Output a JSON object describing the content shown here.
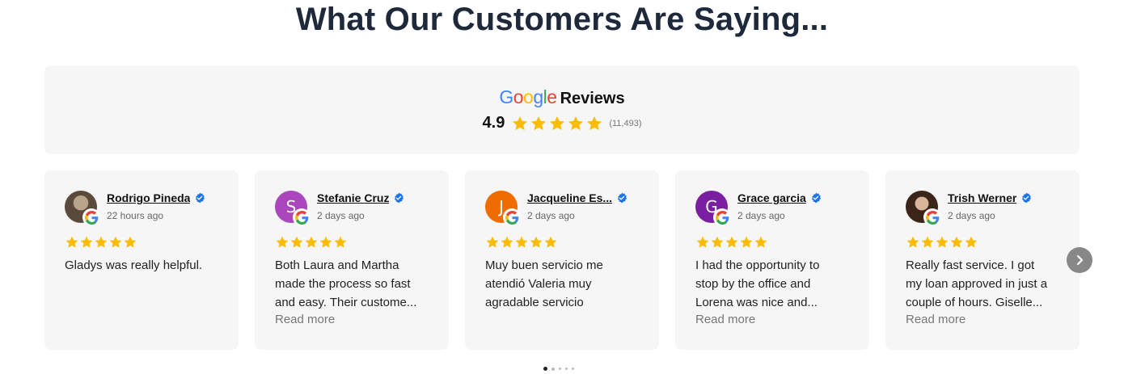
{
  "page": {
    "title": "What Our Customers Are Saying..."
  },
  "summary": {
    "brand": "Google",
    "label": "Reviews",
    "rating": "4.9",
    "stars": 5,
    "count": "(11,493)"
  },
  "colors": {
    "star": "#fbbc05",
    "verified": "#1a73e8",
    "google_blue": "#4285f4",
    "google_red": "#ea4335",
    "google_yellow": "#fbbc05",
    "google_green": "#34a853"
  },
  "reviews": [
    {
      "name": "Rodrigo Pineda",
      "time": "22 hours ago",
      "avatar": "photo",
      "stars": 5,
      "lines": [
        "Gladys was really helpful."
      ],
      "read_more": ""
    },
    {
      "name": "Stefanie Cruz",
      "time": "2 days ago",
      "avatar_letter": "S",
      "avatar_color": "#ab47bc",
      "stars": 5,
      "lines": [
        "Both Laura and Martha",
        "made the process so fast",
        "and easy. Their custome..."
      ],
      "read_more": "Read more"
    },
    {
      "name": "Jacqueline Es...",
      "time": "2 days ago",
      "avatar_letter": "J",
      "avatar_color": "#ef6c00",
      "stars": 5,
      "lines": [
        "Muy buen servicio me",
        "atendió Valeria muy",
        "agradable servicio"
      ],
      "read_more": ""
    },
    {
      "name": "Grace garcia",
      "time": "2 days ago",
      "avatar_letter": "G",
      "avatar_color": "#7b1fa2",
      "stars": 5,
      "lines": [
        "I had the opportunity to",
        "stop by the office and",
        "Lorena was nice and..."
      ],
      "read_more": "Read more"
    },
    {
      "name": "Trish Werner",
      "time": "2 days ago",
      "avatar": "photo",
      "stars": 5,
      "lines": [
        "Really fast service. I got",
        "my loan approved in just a",
        "couple of hours. Giselle..."
      ],
      "read_more": "Read more"
    }
  ],
  "carousel": {
    "next_icon": "chevron-right-icon",
    "pages": 5,
    "active_page": 1
  }
}
